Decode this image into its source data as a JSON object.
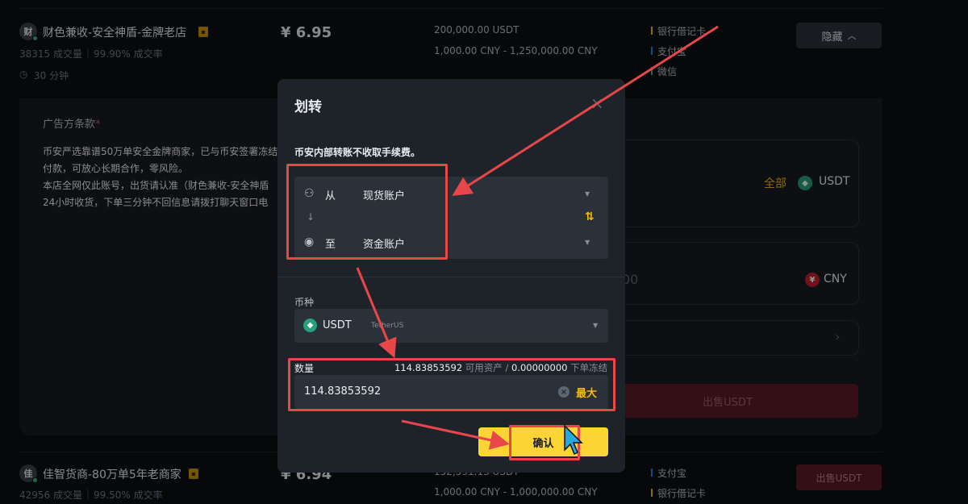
{
  "merchants": [
    {
      "avatar": "财",
      "name": "财色兼收-安全神盾-金牌老店",
      "orders": "38315 成交量",
      "rate": "99.90% 成交率",
      "time": "30 分钟",
      "price": "¥ 6.95",
      "available": "200,000.00 USDT",
      "limit": "1,000.00 CNY - 1,250,000.00 CNY",
      "payments": [
        {
          "label": "银行借记卡",
          "color": "#f0b90b"
        },
        {
          "label": "支付宝",
          "color": "#1e80ff"
        },
        {
          "label": "微信",
          "color": "#2ebd85"
        }
      ],
      "action": "隐藏"
    },
    {
      "avatar": "佳",
      "name": "佳智货商-80万单5年老商家",
      "orders": "42956 成交量",
      "rate": "99.50% 成交率",
      "price": "¥ 6.94",
      "available": "152,591.13 USDT",
      "limit": "1,000.00 CNY - 1,000,000.00 CNY",
      "payments": [
        {
          "label": "支付宝",
          "color": "#1e80ff"
        },
        {
          "label": "银行借记卡",
          "color": "#f0b90b"
        }
      ],
      "action": "出售USDT"
    }
  ],
  "terms": {
    "title": "广告方条款",
    "lines": [
      "币安严选靠谱50万单安全金牌商家，已与币安签署冻结",
      "付款，可放心长期合作，零风险。",
      "本店全网仅此账号，出货请认准（财色兼收-安全神盾",
      "24小时收货，下单三分钟不回信息请拨打聊天窗口电"
    ]
  },
  "order_panel": {
    "all_label": "全部",
    "crypto": "USDT",
    "fiat": "CNY",
    "amount_partial": "00",
    "sell_label": "出售USDT"
  },
  "modal": {
    "title": "划转",
    "close": "×",
    "note": "币安内部转账不收取手续费。",
    "from_label": "从",
    "from_account": "现货账户",
    "to_label": "至",
    "to_account": "资金账户",
    "coin_label": "币种",
    "coin": "USDT",
    "coin_full": "TetherUS",
    "amount_label": "数量",
    "available_value": "114.83853592",
    "available_text": "可用资产 /",
    "frozen_value": "0.00000000",
    "frozen_text": "下单冻结",
    "amount_input": "114.83853592",
    "max_label": "最大",
    "confirm_label": "确认"
  },
  "colors": {
    "accent": "#fcd535",
    "sell": "#f6465d",
    "annotation": "#e8474a"
  }
}
